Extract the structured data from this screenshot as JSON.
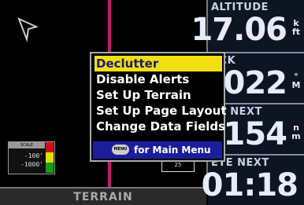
{
  "map": {
    "scale_title": "SCALE",
    "scale_values": [
      "-100'",
      "-1000'"
    ],
    "zoom_scale": "25",
    "page_name": "TERRAIN",
    "colors": {
      "track": "#c0206a",
      "scale_red": "#d01010",
      "scale_yellow": "#e0e000",
      "scale_green": "#10a010"
    }
  },
  "fields": [
    {
      "label": "ALTITUDE",
      "value": "17.06",
      "unit": "kft"
    },
    {
      "label": "ACK",
      "value": "022",
      "unit": "°M"
    },
    {
      "label": "ST NEXT",
      "value": "154",
      "unit": "nm"
    },
    {
      "label": "ETE NEXT",
      "value": "01:18",
      "unit": ""
    }
  ],
  "menu": {
    "items": [
      {
        "label": "Declutter",
        "selected": true
      },
      {
        "label": "Disable Alerts",
        "selected": false
      },
      {
        "label": "Set Up Terrain",
        "selected": false
      },
      {
        "label": "Set Up Page Layout",
        "selected": false
      },
      {
        "label": "Change Data Fields",
        "selected": false
      }
    ],
    "footer_button": "MENU",
    "footer_text": "for Main Menu",
    "colors": {
      "highlight": "#f0e010",
      "footer_bg": "#1b1e9a"
    }
  },
  "icons": {
    "north_arrow": "north-arrow-icon",
    "menu_button": "menu-button-icon"
  }
}
